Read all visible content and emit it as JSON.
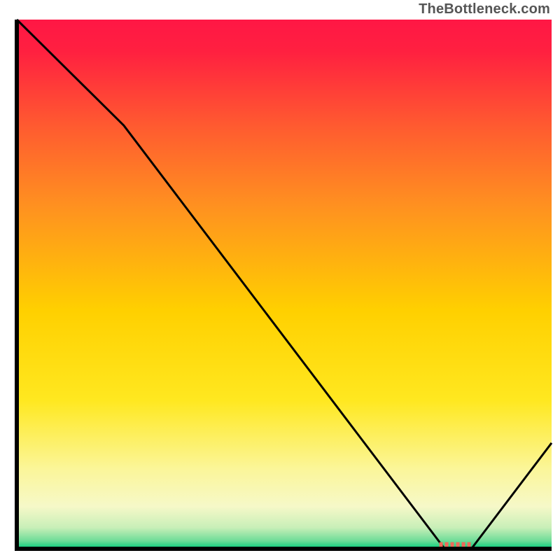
{
  "watermark": "TheBottleneck.com",
  "chart_data": {
    "type": "line",
    "title": "",
    "xlabel": "",
    "ylabel": "",
    "xlim": [
      0,
      100
    ],
    "ylim": [
      0,
      100
    ],
    "x": [
      0,
      20,
      80,
      85,
      100
    ],
    "values": [
      100,
      80,
      0,
      0,
      20
    ],
    "gradient_stops": [
      {
        "offset": 0.0,
        "color": "#ff1745"
      },
      {
        "offset": 0.06,
        "color": "#ff2040"
      },
      {
        "offset": 0.2,
        "color": "#ff5a30"
      },
      {
        "offset": 0.35,
        "color": "#ff9020"
      },
      {
        "offset": 0.55,
        "color": "#ffd000"
      },
      {
        "offset": 0.72,
        "color": "#ffe820"
      },
      {
        "offset": 0.85,
        "color": "#fbf69a"
      },
      {
        "offset": 0.92,
        "color": "#f6f8c8"
      },
      {
        "offset": 0.96,
        "color": "#c8efb8"
      },
      {
        "offset": 0.985,
        "color": "#6edc98"
      },
      {
        "offset": 1.0,
        "color": "#00cc7a"
      }
    ],
    "marker": {
      "x": 82,
      "y": 0,
      "width": 6,
      "color": "#ee6a5a"
    },
    "border_color": "#000000",
    "line_color": "#000000"
  }
}
